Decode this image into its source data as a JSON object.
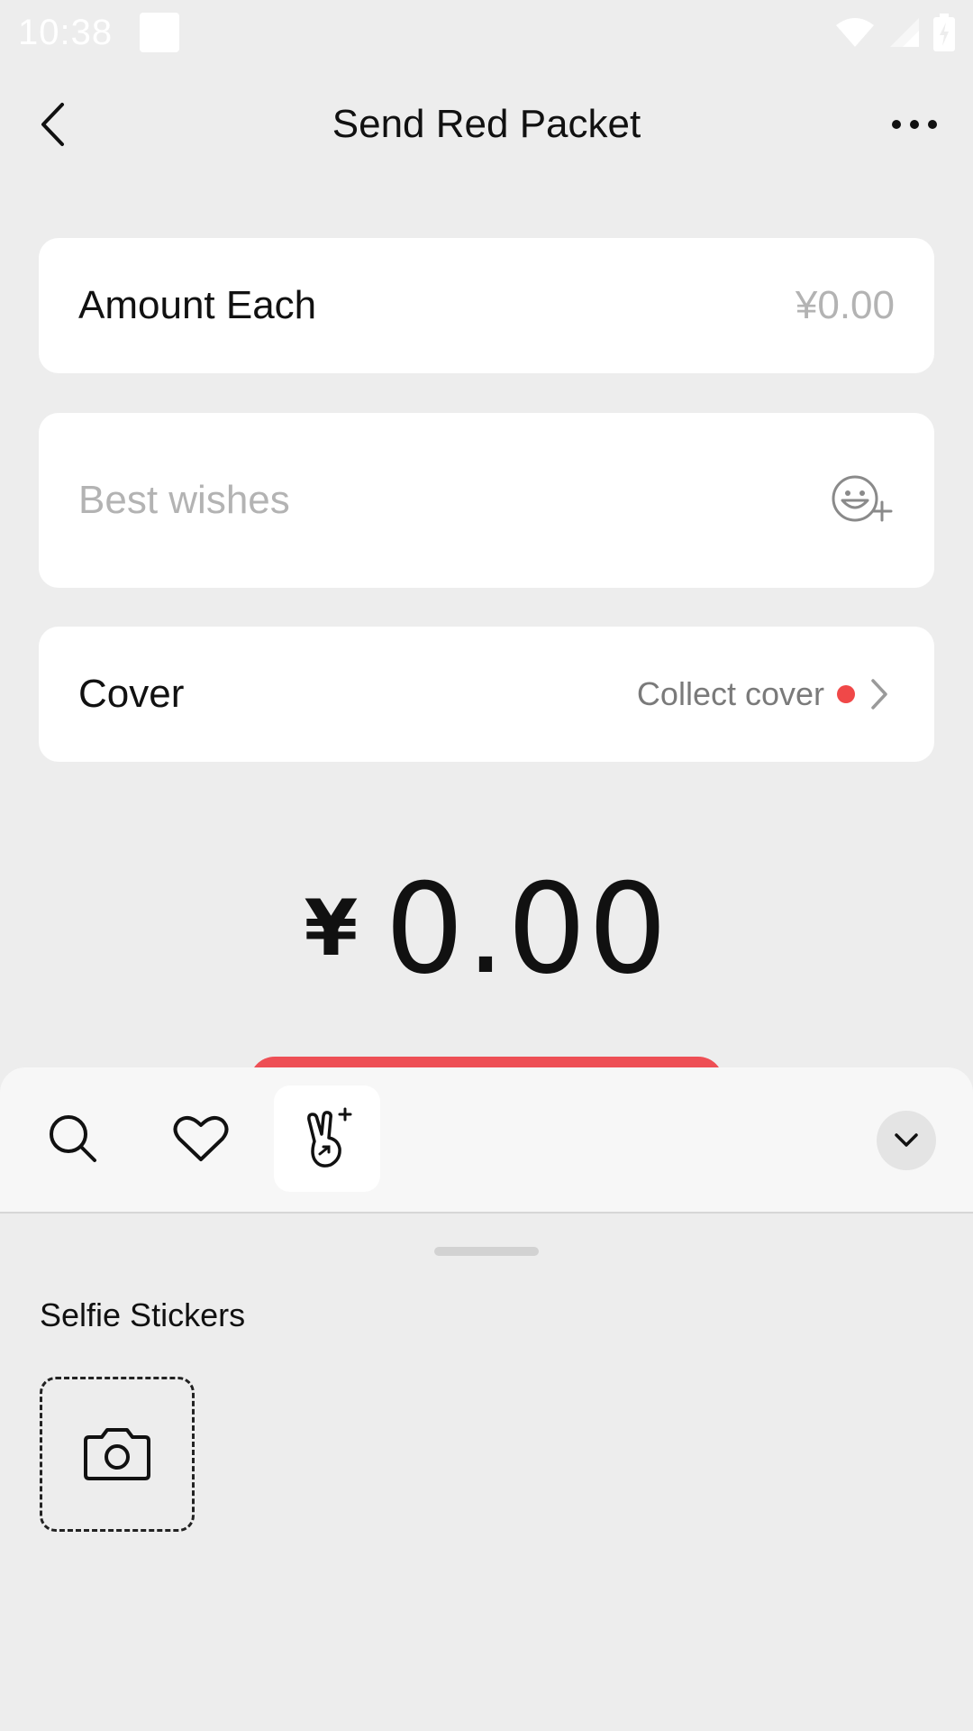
{
  "status_bar": {
    "time": "10:38",
    "icons": [
      "wifi-icon",
      "signal-icon",
      "battery-icon"
    ]
  },
  "header": {
    "title": "Send Red Packet",
    "back_icon": "chevron-left-icon",
    "more_icon": "more-dots-icon"
  },
  "amount_card": {
    "label": "Amount Each",
    "value": "¥0.00"
  },
  "wish_card": {
    "placeholder": "Best wishes",
    "emoji_icon": "emoji-add-icon"
  },
  "cover_card": {
    "label": "Cover",
    "link_text": "Collect cover",
    "dot_color": "#f04848"
  },
  "total": {
    "currency": "¥",
    "value": "0.00"
  },
  "colors": {
    "accent_red": "#ee4f55",
    "background": "#ededed"
  },
  "sticker_panel": {
    "tabs": [
      {
        "icon": "search-icon"
      },
      {
        "icon": "heart-icon"
      },
      {
        "icon": "selfie-sticker-icon",
        "selected": true
      }
    ],
    "collapse_icon": "chevron-down-icon",
    "section_title": "Selfie Stickers",
    "camera_icon": "camera-icon"
  }
}
